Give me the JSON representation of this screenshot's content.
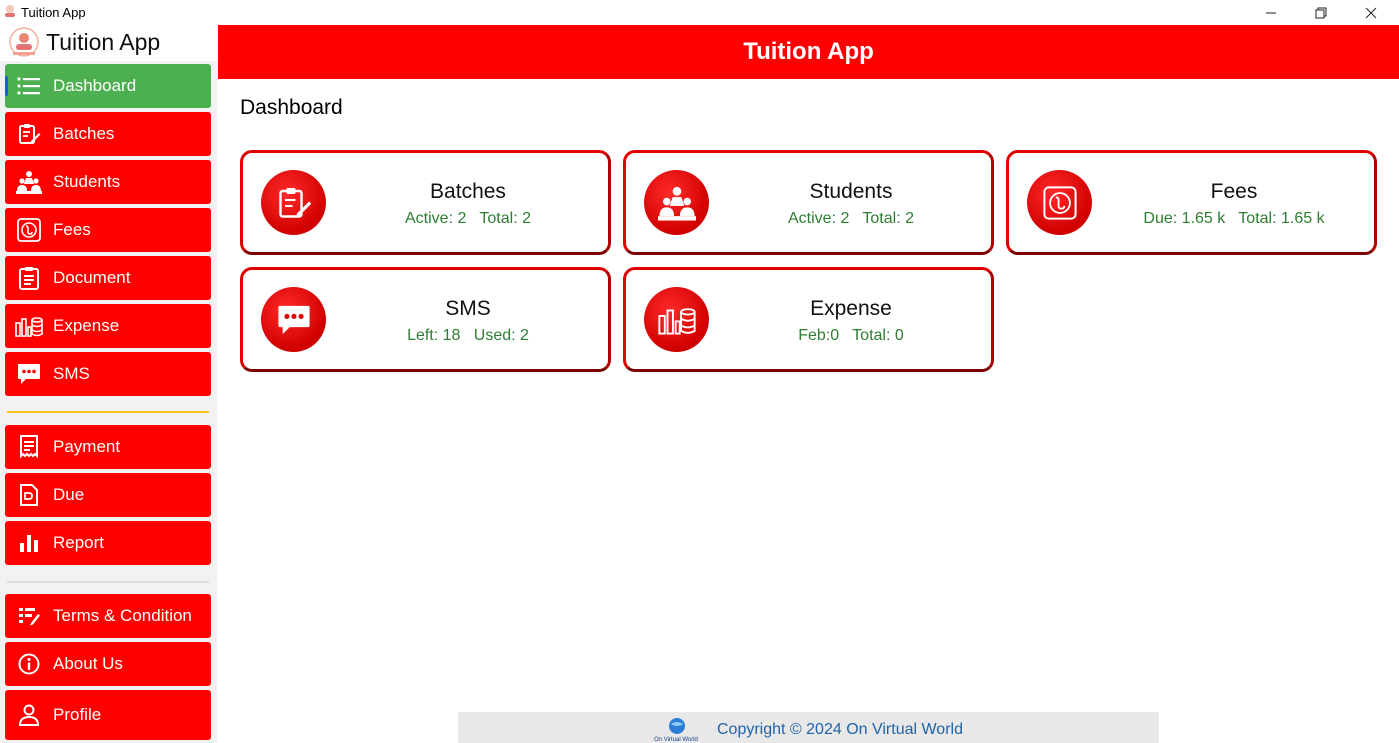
{
  "window": {
    "title": "Tuition App",
    "icon": "app-logo-icon"
  },
  "brand": {
    "name": "Tuition App",
    "logo": "brand-logo"
  },
  "sidebar": {
    "items": [
      {
        "label": "Dashboard",
        "icon": "list-icon",
        "active": true
      },
      {
        "label": "Batches",
        "icon": "clipboard-edit-icon"
      },
      {
        "label": "Students",
        "icon": "classroom-icon"
      },
      {
        "label": "Fees",
        "icon": "taka-coin-icon"
      },
      {
        "label": "Document",
        "icon": "document-icon"
      },
      {
        "label": "Expense",
        "icon": "expense-coins-icon"
      },
      {
        "label": "SMS",
        "icon": "chat-bubble-icon"
      }
    ],
    "items2": [
      {
        "label": "Payment",
        "icon": "receipt-icon"
      },
      {
        "label": "Due",
        "icon": "due-icon"
      },
      {
        "label": "Report",
        "icon": "bar-chart-icon"
      }
    ],
    "items3": [
      {
        "label": "Terms & Condition",
        "icon": "terms-icon"
      },
      {
        "label": "About Us",
        "icon": "info-icon"
      },
      {
        "label": "Profile",
        "icon": "person-icon"
      }
    ]
  },
  "header": {
    "title": "Tuition App"
  },
  "main": {
    "page_title": "Dashboard",
    "cards": [
      {
        "title": "Batches",
        "stats": "Active: 2   Total: 2",
        "icon": "clipboard-edit-icon"
      },
      {
        "title": "Students",
        "stats": "Active: 2   Total: 2",
        "icon": "classroom-icon"
      },
      {
        "title": "Fees",
        "stats": "Due: 1.65 k   Total: 1.65 k",
        "icon": "taka-coin-icon"
      },
      {
        "title": "SMS",
        "stats": "Left: 18   Used: 2",
        "icon": "chat-bubble-icon"
      },
      {
        "title": "Expense",
        "stats": "Feb:0   Total: 0",
        "icon": "expense-coins-icon"
      }
    ]
  },
  "footer": {
    "text": "Copyright © 2024 On Virtual World",
    "logo": "on-virtual-world-logo"
  },
  "colors": {
    "primary": "#ff0000",
    "active": "#4caf50",
    "stats_text": "#2e7d32",
    "footer_text": "#1e63a8"
  }
}
